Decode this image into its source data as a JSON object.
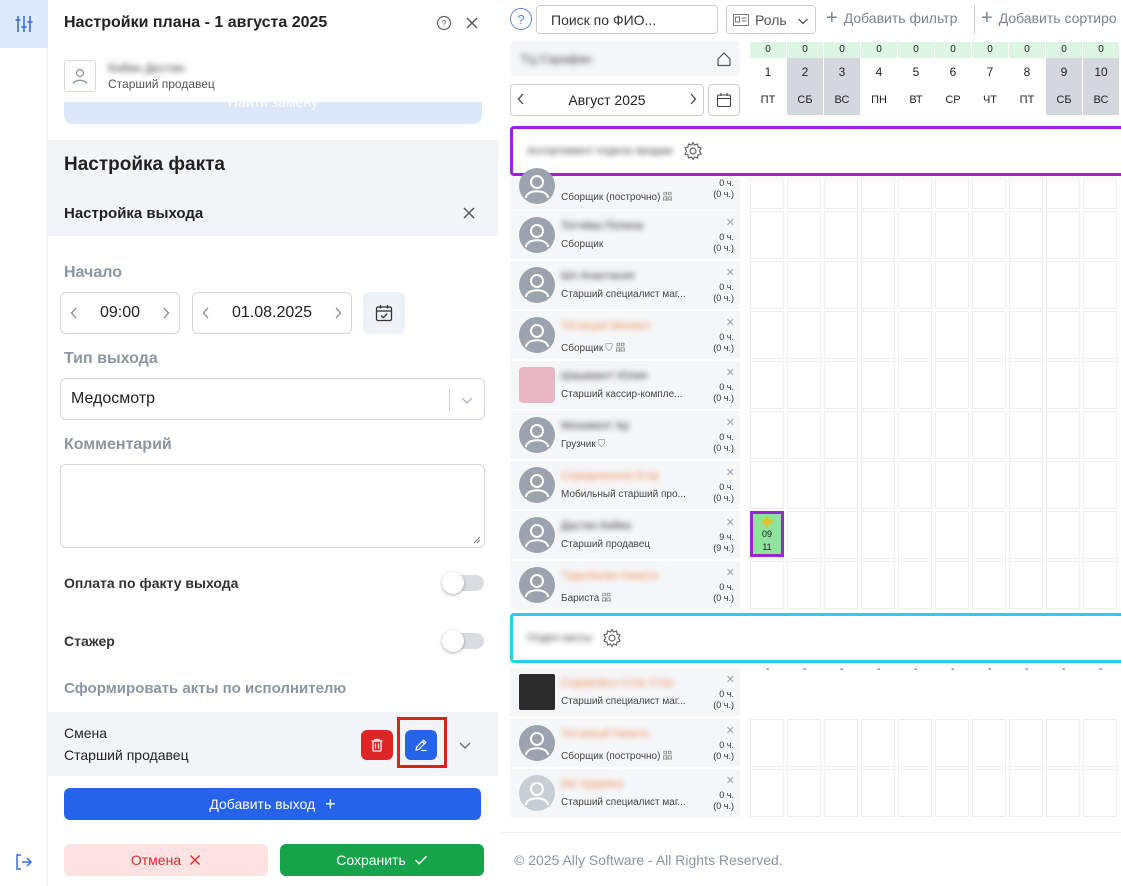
{
  "panel": {
    "title": "Настройки плана - 1 августа 2025",
    "employee": {
      "name": "Кейин Дестин",
      "role": "Старший продавец"
    },
    "find_replacement": "Найти замену",
    "fact_title": "Настройка факта",
    "exit_title": "Настройка выхода",
    "start_label": "Начало",
    "start_time": "09:00",
    "start_date": "01.08.2025",
    "exit_type_label": "Тип выхода",
    "exit_type_value": "Медосмотр",
    "comment_label": "Комментарий",
    "pay_by_fact_label": "Оплата по факту выхода",
    "pay_by_fact_on": false,
    "trainee_label": "Стажер",
    "trainee_on": false,
    "acts_label": "Сформировать акты по исполнителю",
    "shift": {
      "line1": "Смена",
      "line2": "Старший продавец"
    },
    "add_exit_label": "Добавить выход",
    "cancel_label": "Отмена",
    "save_label": "Сохранить"
  },
  "toolbar": {
    "help": "?",
    "search_placeholder": "Поиск по ФИО...",
    "role_label": "Роль",
    "add_filter_label": "Добавить фильтр",
    "add_sort_label": "Добавить сортиро"
  },
  "schedule": {
    "store_filter": "ТЦ Сарафан",
    "month_label": "Август 2025",
    "days": [
      {
        "count": "0",
        "num": "1",
        "wd": "ПТ",
        "weekend": false
      },
      {
        "count": "0",
        "num": "2",
        "wd": "СБ",
        "weekend": true
      },
      {
        "count": "0",
        "num": "3",
        "wd": "ВС",
        "weekend": true
      },
      {
        "count": "0",
        "num": "4",
        "wd": "ПН",
        "weekend": false
      },
      {
        "count": "0",
        "num": "5",
        "wd": "ВТ",
        "weekend": false
      },
      {
        "count": "0",
        "num": "6",
        "wd": "СР",
        "weekend": false
      },
      {
        "count": "0",
        "num": "7",
        "wd": "ЧТ",
        "weekend": false
      },
      {
        "count": "0",
        "num": "8",
        "wd": "ПТ",
        "weekend": false
      },
      {
        "count": "0",
        "num": "9",
        "wd": "СБ",
        "weekend": true
      },
      {
        "count": "0",
        "num": "10",
        "wd": "ВС",
        "weekend": true
      }
    ],
    "group1": "Ассортимент отдела продаж",
    "group2": "Отдел кассы",
    "employees_group1": [
      {
        "name": "Павлов Артём",
        "role": "Сборщик (построчно)",
        "hours": "0 ч.",
        "hours2": "(0 ч.)",
        "ava": "grey",
        "orange": false,
        "icon": "㗊"
      },
      {
        "name": "Тетчёва Полина",
        "role": "Сборщик",
        "hours": "0 ч.",
        "hours2": "(0 ч.)",
        "ava": "grey",
        "orange": false,
        "icon": ""
      },
      {
        "name": "Шл Анастасия",
        "role": "Старший специалист маг...",
        "hours": "0 ч.",
        "hours2": "(0 ч.)",
        "ava": "grey",
        "orange": false,
        "icon": ""
      },
      {
        "name": "Тягнецов Михаил",
        "role": "Сборщик",
        "hours": "0 ч.",
        "hours2": "(0 ч.)",
        "ava": "grey",
        "orange": true,
        "icon": "⛉ 㗊"
      },
      {
        "name": "Шашмангт Юлия",
        "role": "Старший кассир-компле...",
        "hours": "0 ч.",
        "hours2": "(0 ч.)",
        "ava": "pink",
        "orange": false,
        "icon": ""
      },
      {
        "name": "Мохимент Ар",
        "role": "Грузчик",
        "hours": "0 ч.",
        "hours2": "(0 ч.)",
        "ava": "grey",
        "orange": false,
        "icon": "⛉"
      },
      {
        "name": "Середнишнов Егор",
        "role": "Мобильный старший про...",
        "hours": "0 ч.",
        "hours2": "(0 ч.)",
        "ava": "grey",
        "orange": true,
        "icon": ""
      },
      {
        "name": "Дастин Кейин",
        "role": "Старший продавец",
        "hours": "9 ч.",
        "hours2": "(9 ч.)",
        "ava": "grey",
        "orange": false,
        "icon": ""
      },
      {
        "name": "Тадыбалин Никита",
        "role": "Бариста",
        "hours": "0 ч.",
        "hours2": "(0 ч.)",
        "ava": "grey",
        "orange": true,
        "icon": "㗊"
      }
    ],
    "employees_group2": [
      {
        "name": "Сидоровых Стас Стас",
        "role": "Старший специалист маг...",
        "hours": "0 ч.",
        "hours2": "(0 ч.)",
        "ava": "dark",
        "orange": true,
        "icon": ""
      },
      {
        "name": "Тетчевый Никита",
        "role": "Сборщик (построчно)",
        "hours": "0 ч.",
        "hours2": "(0 ч.)",
        "ava": "grey",
        "orange": true,
        "icon": "㗊"
      },
      {
        "name": "Ми Ударина",
        "role": "Старший специалист маг...",
        "hours": "0 ч.",
        "hours2": "(0 ч.)",
        "ava": "light",
        "orange": true,
        "icon": ""
      }
    ],
    "shift_cell": {
      "start": "09",
      "end": "11"
    },
    "dash": "-"
  },
  "footer": {
    "copyright": "© 2025 Ally Software - All Rights Reserved."
  },
  "colors": {
    "accent": "#2563eb",
    "danger": "#dc2626",
    "success": "#16a34a",
    "group1_border": "#a020e0",
    "group2_border": "#22d3e8",
    "shift_outline": "#9b24d8"
  }
}
